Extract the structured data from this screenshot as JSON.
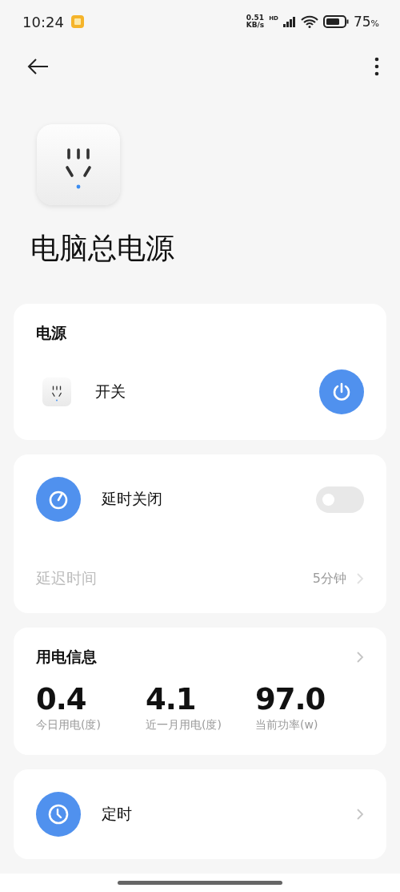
{
  "status_bar": {
    "time": "10:24",
    "speed_value": "0.51",
    "speed_unit": "KB/s",
    "network_badge": "HD",
    "battery_percent": "75",
    "percent_sign": "%"
  },
  "device": {
    "name": "电脑总电源"
  },
  "sections": [
    {
      "kind": "power",
      "title": "电源",
      "label": "开关",
      "on": true
    },
    {
      "kind": "delay",
      "title": "延时关闭",
      "on": false,
      "detail_label": "延迟时间",
      "detail_value": "5分钟",
      "disabled": true
    },
    {
      "kind": "stats",
      "title": "用电信息",
      "stats": [
        {
          "value": "0.4",
          "label": "今日用电(度)"
        },
        {
          "value": "4.1",
          "label": "近一月用电(度)"
        },
        {
          "value": "97.0",
          "label": "当前功率(w)"
        }
      ]
    },
    {
      "kind": "timer",
      "title": "定时"
    }
  ]
}
